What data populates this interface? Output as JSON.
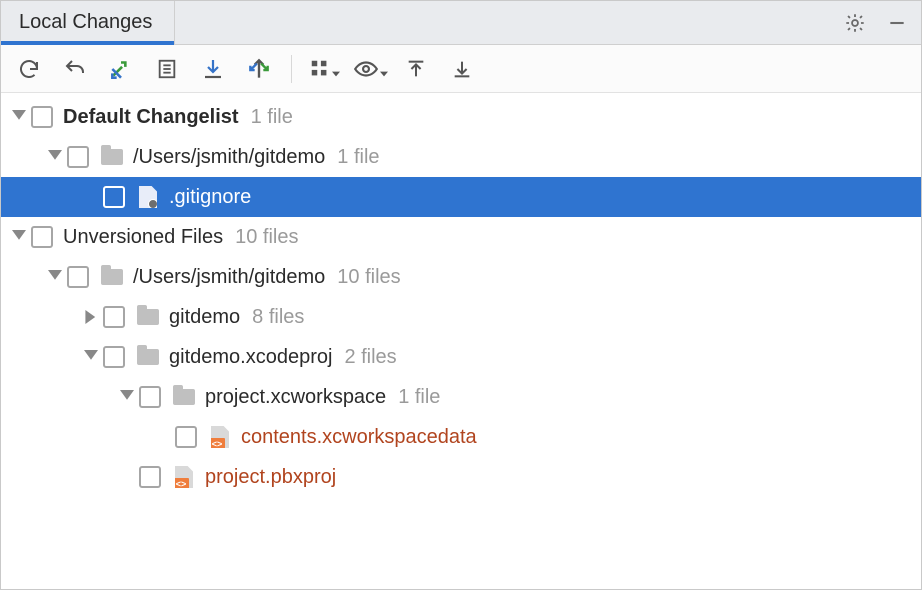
{
  "header": {
    "tab_title": "Local Changes"
  },
  "toolbar": {
    "refresh": "Refresh",
    "rollback": "Rollback",
    "commit": "Commit",
    "changelist": "Changelists",
    "shelve": "Shelve Silently",
    "diff": "Show Diff",
    "groupby": "Group By",
    "preview": "Preview Diff",
    "expand": "Expand All",
    "collapse": "Collapse All"
  },
  "tree": {
    "default": {
      "label": "Default Changelist",
      "count": "1 file",
      "path": {
        "label": "/Users/jsmith/gitdemo",
        "count": "1 file",
        "file": {
          "label": ".gitignore"
        }
      }
    },
    "unversioned": {
      "label": "Unversioned Files",
      "count": "10 files",
      "path": {
        "label": "/Users/jsmith/gitdemo",
        "count": "10 files",
        "gitdemo": {
          "label": "gitdemo",
          "count": "8 files"
        },
        "xcodeproj": {
          "label": "gitdemo.xcodeproj",
          "count": "2 files",
          "workspace": {
            "label": "project.xcworkspace",
            "count": "1 file",
            "file": {
              "label": "contents.xcworkspacedata"
            }
          },
          "pbx": {
            "label": "project.pbxproj"
          }
        }
      }
    }
  }
}
